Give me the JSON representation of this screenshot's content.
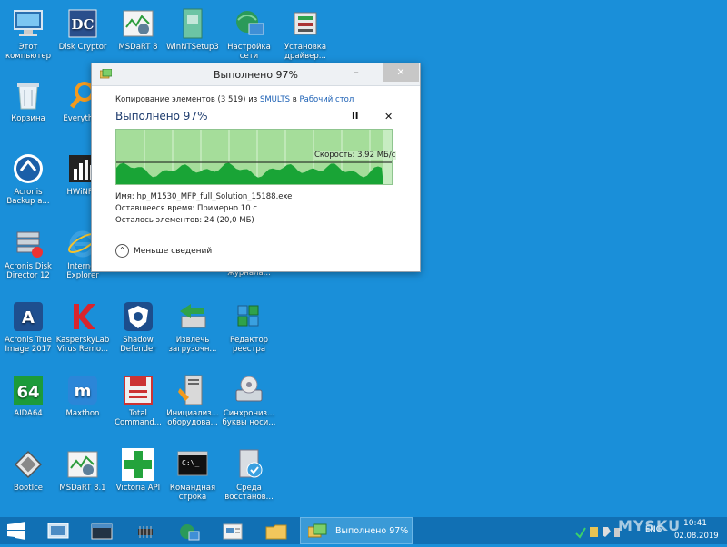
{
  "desktop": {
    "icons": {
      "computer": "Этот компьютер",
      "diskcryptor": "Disk Cryptor",
      "msdart8": "MSDaRT 8",
      "winntsetup": "WinNTSetup3",
      "network": "Настройка сети",
      "driver_install": "Установка драйвер...",
      "recycle": "Корзина",
      "everything": "Everythi...",
      "acronis_backup": "Acronis Backup a...",
      "hwinfo": "HWiNF...",
      "acronis_disk": "Acronis Disk Director 12",
      "ie": "Internet Explorer",
      "journal": "журнала...",
      "acronis_true": "Acronis True Image 2017",
      "kaspersky": "KasperskyLab Virus Remo...",
      "shadow": "Shadow Defender",
      "extract": "Извлечь загрузочн...",
      "regedit": "Редактор реестра",
      "aida": "AIDA64",
      "maxthon": "Maxthon",
      "total": "Total Command...",
      "init": "Инициализ... оборудова...",
      "sync": "Синхрониз... буквы носи...",
      "bootice": "BootIce",
      "msdart81": "MSDaRT 8.1",
      "victoria": "Victoria API",
      "cmd": "Командная строка",
      "env": "Среда восстанов..."
    }
  },
  "dialog": {
    "title": "Выполнено 97%",
    "minimize": "–",
    "maximize": "□",
    "close": "✕",
    "copy_prefix": "Копирование элементов (3 519) из ",
    "source": "SMULTS",
    "copy_mid": " в ",
    "destination": "Рабочий стол",
    "progress_heading": "Выполнено 97%",
    "pause": "II",
    "stop": "✕",
    "speed": "Скорость: 3,92 МБ/с",
    "progress_percent": 97,
    "name_label": "Имя:",
    "name_value": "hp_M1530_MFP_full_Solution_15188.exe",
    "time_label": "Оставшееся время:",
    "time_value": "Примерно 10 с",
    "items_label": "Осталось элементов:",
    "items_value": "24 (20,0 МБ)",
    "less_details": "Меньше сведений"
  },
  "taskbar": {
    "active_task": "Выполнено 97%",
    "lang": "ENG",
    "time": "10:41",
    "date": "02.08.2019",
    "watermark": "MYSKU"
  },
  "colors": {
    "desktop": "#1a8fd9",
    "taskbar": "#1170b4",
    "graph_bg": "#c7ecc2",
    "graph_fill": "#19a436",
    "link": "#1a5fb4"
  }
}
